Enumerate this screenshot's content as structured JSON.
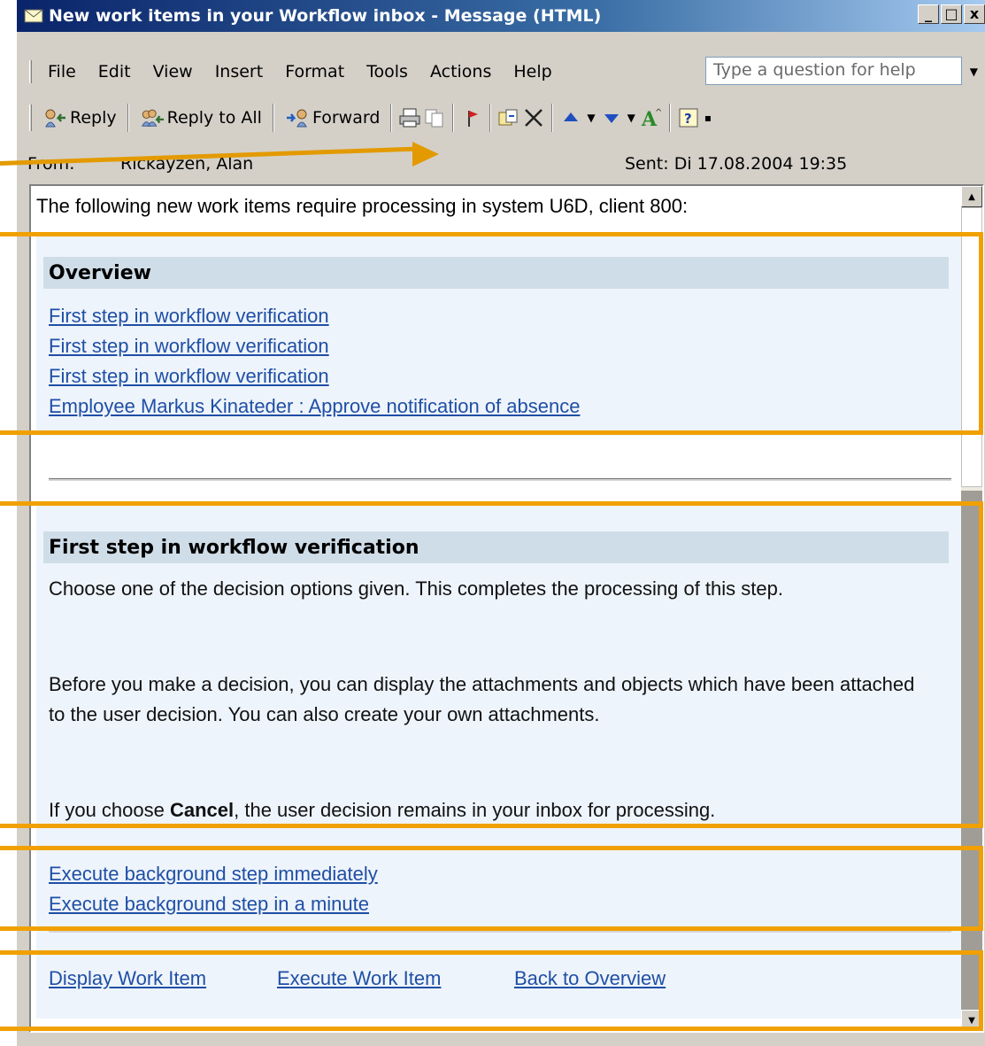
{
  "window": {
    "title": "New work items in your Workflow inbox - Message (HTML)",
    "controls": [
      "_",
      "□",
      "x"
    ]
  },
  "menu": {
    "items": [
      "File",
      "Edit",
      "View",
      "Insert",
      "Format",
      "Tools",
      "Actions",
      "Help"
    ],
    "help_placeholder": "Type a question for help"
  },
  "toolbar": {
    "reply": "Reply",
    "reply_all": "Reply to All",
    "forward": "Forward"
  },
  "header": {
    "from_label": "From:",
    "from_value": "Rickayzen, Alan",
    "sent_label": "Sent:",
    "sent_value": "Di 17.08.2004 19:35"
  },
  "message": {
    "intro": "The following new work items require processing in system U6D, client 800:",
    "overview": {
      "heading": "Overview",
      "links": [
        "First step in workflow verification",
        "First step in workflow verification",
        "First step in workflow verification",
        "Employee Markus Kinateder : Approve notification of absence"
      ]
    },
    "detail": {
      "heading": "First step in workflow verification",
      "para1": "Choose one of the decision options given. This completes the processing of this step.",
      "para2": "Before you make a decision, you can display the attachments and objects which have been attached to the user decision. You can also create your own attachments.",
      "para3_pre": "If you choose ",
      "para3_bold": "Cancel",
      "para3_post": ", the user decision remains in your inbox for processing."
    },
    "decisions": [
      "Execute background step immediately",
      "Execute background step in a minute"
    ],
    "actions": [
      "Display Work Item",
      "Execute Work Item",
      "Back to Overview"
    ]
  },
  "colors": {
    "highlight": "#f0a000",
    "link": "#1f4fa5",
    "panel": "#eef4fb",
    "section_head": "#cfdde8"
  }
}
